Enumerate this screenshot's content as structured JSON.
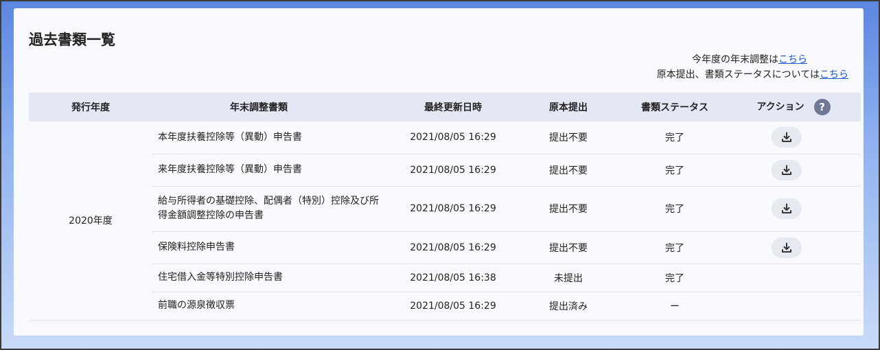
{
  "page_title": "過去書類一覧",
  "links": {
    "line1_text": "今年度の年末調整は",
    "line1_link": "こちら",
    "line2_text": "原本提出、書類ステータスについては",
    "line2_link": "こちら"
  },
  "table": {
    "headers": {
      "year": "発行年度",
      "document": "年末調整書類",
      "updated": "最終更新日時",
      "original": "原本提出",
      "status": "書類ステータス",
      "action": "アクション",
      "help": "?"
    },
    "year_value": "2020年度",
    "rows": [
      {
        "document": "本年度扶養控除等（異動）申告書",
        "updated": "2021/08/05 16:29",
        "original": "提出不要",
        "status": "完了",
        "download": true
      },
      {
        "document": "来年度扶養控除等（異動）申告書",
        "updated": "2021/08/05 16:29",
        "original": "提出不要",
        "status": "完了",
        "download": true
      },
      {
        "document": "給与所得者の基礎控除、配偶者（特別）控除及び所得金額調整控除の申告書",
        "updated": "2021/08/05 16:29",
        "original": "提出不要",
        "status": "完了",
        "download": true
      },
      {
        "document": "保険料控除申告書",
        "updated": "2021/08/05 16:29",
        "original": "提出不要",
        "status": "完了",
        "download": true
      },
      {
        "document": "住宅借入金等特別控除申告書",
        "updated": "2021/08/05 16:38",
        "original": "未提出",
        "status": "完了",
        "download": false
      },
      {
        "document": "前職の源泉徴収票",
        "updated": "2021/08/05 16:29",
        "original": "提出済み",
        "status": "ー",
        "download": false
      }
    ]
  },
  "icons": {
    "download": "download-icon",
    "help": "question-icon"
  }
}
